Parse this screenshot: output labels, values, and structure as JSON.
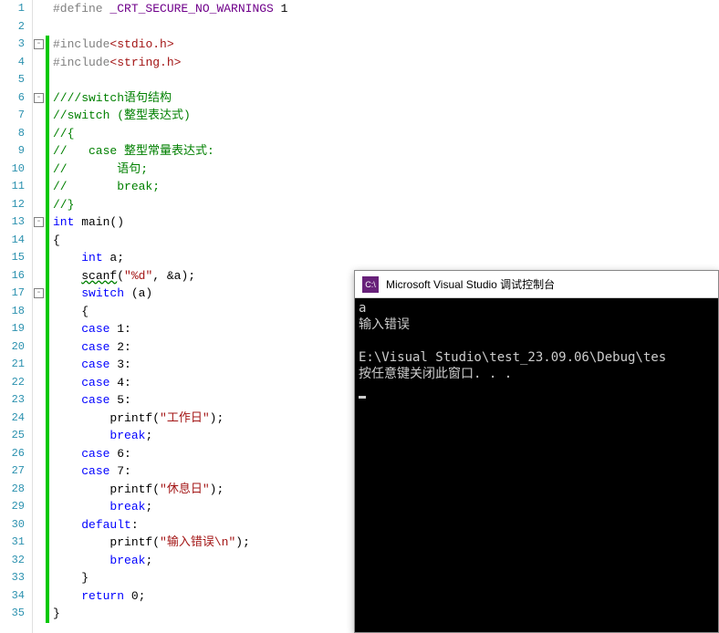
{
  "gutter": {
    "start": 1,
    "end": 35
  },
  "code": {
    "l1": {
      "pp": "#define ",
      "mac": "_CRT_SECURE_NO_WARNINGS",
      "rest": " 1"
    },
    "l3": {
      "pp": "#include",
      "lt": "<",
      "h": "stdio.h",
      "gt": ">"
    },
    "l4": {
      "pp": "#include",
      "lt": "<",
      "h": "string.h",
      "gt": ">"
    },
    "l6": "////switch语句结构",
    "l7": "//switch (整型表达式)",
    "l8": "//{",
    "l9": "//   case 整型常量表达式:",
    "l10": "//       语句;",
    "l11": "//       break;",
    "l12": "//}",
    "l13": {
      "kw_int": "int",
      "main": " main",
      "paren": "()"
    },
    "l14": "{",
    "l15": {
      "indent": "    ",
      "kw_int": "int",
      "rest": " a;"
    },
    "l16": {
      "indent": "    ",
      "fn": "scanf",
      "open": "(",
      "str": "\"%d\"",
      "mid": ", &a",
      "close": ");"
    },
    "l17": {
      "indent": "    ",
      "kw": "switch",
      "rest": " (a)"
    },
    "l18": "    {",
    "l19": {
      "indent": "    ",
      "kw": "case",
      "rest": " 1:"
    },
    "l20": {
      "indent": "    ",
      "kw": "case",
      "rest": " 2:"
    },
    "l21": {
      "indent": "    ",
      "kw": "case",
      "rest": " 3:"
    },
    "l22": {
      "indent": "    ",
      "kw": "case",
      "rest": " 4:"
    },
    "l23": {
      "indent": "    ",
      "kw": "case",
      "rest": " 5:"
    },
    "l24": {
      "indent": "        ",
      "fn": "printf",
      "open": "(",
      "str": "\"工作日\"",
      "close": ");"
    },
    "l25": {
      "indent": "        ",
      "kw": "break",
      "semi": ";"
    },
    "l26": {
      "indent": "    ",
      "kw": "case",
      "rest": " 6:"
    },
    "l27": {
      "indent": "    ",
      "kw": "case",
      "rest": " 7:"
    },
    "l28": {
      "indent": "        ",
      "fn": "printf",
      "open": "(",
      "str": "\"休息日\"",
      "close": ");"
    },
    "l29": {
      "indent": "        ",
      "kw": "break",
      "semi": ";"
    },
    "l30": {
      "indent": "    ",
      "kw": "default",
      "colon": ":"
    },
    "l31": {
      "indent": "        ",
      "fn": "printf",
      "open": "(",
      "str": "\"输入错误\\n\"",
      "close": ");"
    },
    "l32": {
      "indent": "        ",
      "kw": "break",
      "semi": ";"
    },
    "l33": "    }",
    "l34": {
      "indent": "    ",
      "kw": "return",
      "rest": " 0;"
    },
    "l35": "}"
  },
  "console": {
    "icon_text": "C:\\",
    "title": "Microsoft Visual Studio 调试控制台",
    "line1": "a",
    "line2": "输入错误",
    "line3": "",
    "line4": "E:\\Visual Studio\\test_23.09.06\\Debug\\tes",
    "line5": "按任意键关闭此窗口. . ."
  }
}
